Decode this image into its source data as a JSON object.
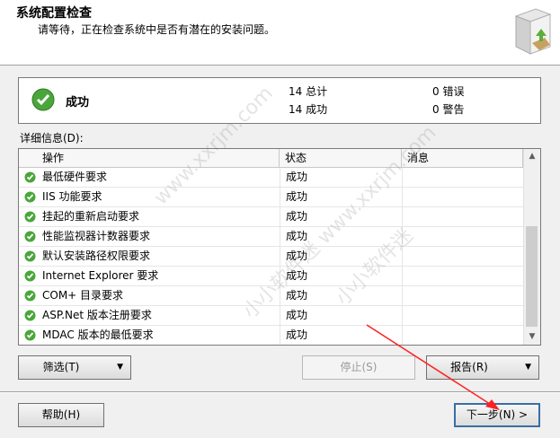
{
  "header": {
    "title": "系统配置检查",
    "subtitle": "请等待，正在检查系统中是否有潜在的安装问题。",
    "icon": "install-box-icon"
  },
  "summary": {
    "status": "成功",
    "total_label": "14 总计",
    "success_label": "14 成功",
    "error_label": "0 错误",
    "warning_label": "0 警告",
    "status_color": "#3c9a2e"
  },
  "details_label": "详细信息(D):",
  "grid": {
    "columns": [
      "操作",
      "状态",
      "消息"
    ],
    "rows": [
      {
        "operation": "最低硬件要求",
        "status": "成功",
        "message": ""
      },
      {
        "operation": "IIS 功能要求",
        "status": "成功",
        "message": ""
      },
      {
        "operation": "挂起的重新启动要求",
        "status": "成功",
        "message": ""
      },
      {
        "operation": "性能监视器计数器要求",
        "status": "成功",
        "message": ""
      },
      {
        "operation": "默认安装路径权限要求",
        "status": "成功",
        "message": ""
      },
      {
        "operation": "Internet Explorer 要求",
        "status": "成功",
        "message": ""
      },
      {
        "operation": "COM+ 目录要求",
        "status": "成功",
        "message": ""
      },
      {
        "operation": "ASP.Net 版本注册要求",
        "status": "成功",
        "message": ""
      },
      {
        "operation": "MDAC 版本的最低要求",
        "status": "成功",
        "message": ""
      }
    ]
  },
  "buttons": {
    "filter": "筛选(T)",
    "stop": "停止(S)",
    "report": "报告(R)",
    "help": "帮助(H)",
    "next": "下一步(N) >"
  },
  "watermark": [
    "www.xxrjm.com",
    "小小软件迷 www.xxrjm.com",
    "小小软件迷"
  ]
}
